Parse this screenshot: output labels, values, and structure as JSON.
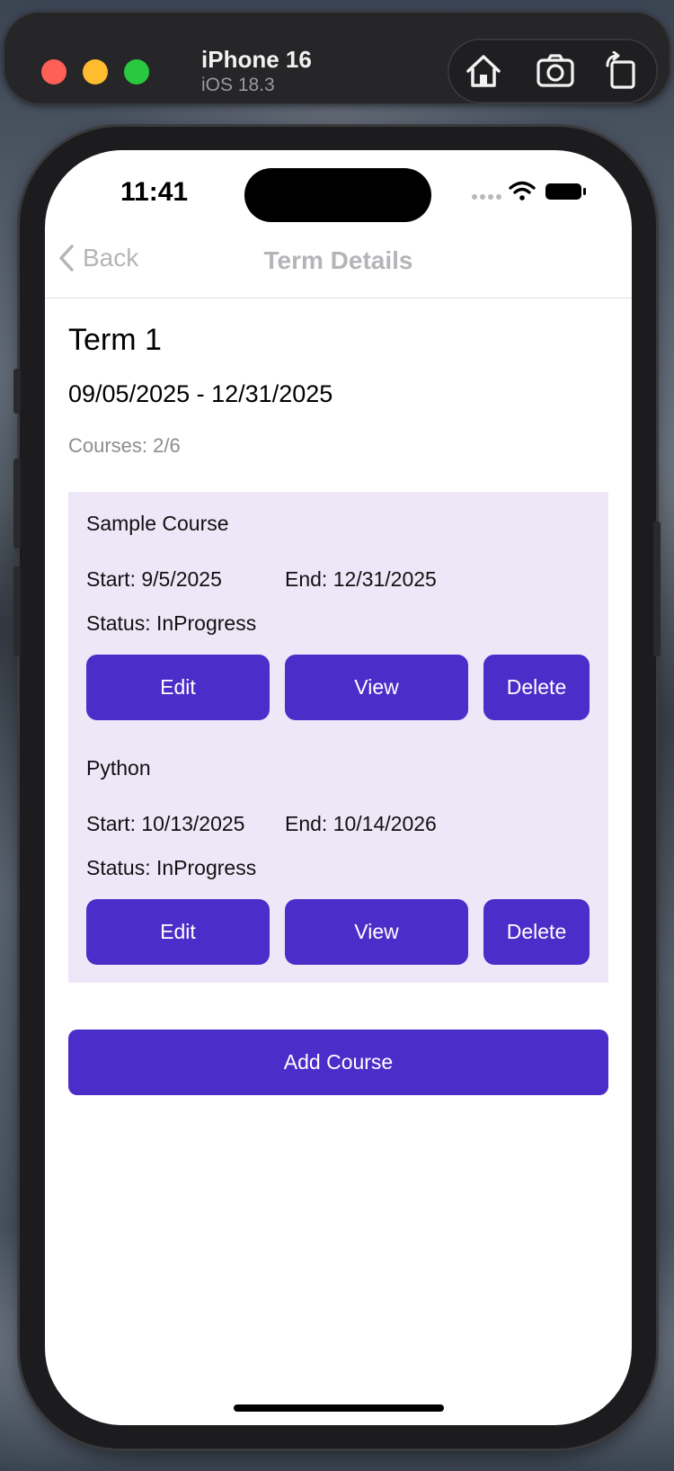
{
  "simulator": {
    "device_name": "iPhone 16",
    "os_version": "iOS 18.3",
    "icons": [
      "home-icon",
      "screenshot-icon",
      "rotate-icon"
    ]
  },
  "status_bar": {
    "time": "11:41",
    "icons": [
      "signal-dots-icon",
      "wifi-icon",
      "battery-icon"
    ]
  },
  "nav": {
    "back_label": "Back",
    "title": "Term Details"
  },
  "term": {
    "title": "Term 1",
    "dates": "09/05/2025 - 12/31/2025",
    "courses_count": "Courses: 2/6"
  },
  "courses": [
    {
      "name": "Sample Course",
      "start": "Start: 9/5/2025",
      "end": "End: 12/31/2025",
      "status": "Status: InProgress",
      "edit_label": "Edit",
      "view_label": "View",
      "delete_label": "Delete"
    },
    {
      "name": "Python",
      "start": "Start: 10/13/2025",
      "end": "End: 10/14/2026",
      "status": "Status: InProgress",
      "edit_label": "Edit",
      "view_label": "View",
      "delete_label": "Delete"
    }
  ],
  "add_course_label": "Add Course",
  "colors": {
    "accent": "#4b2dc9",
    "panel_bg": "#ede7f8"
  }
}
